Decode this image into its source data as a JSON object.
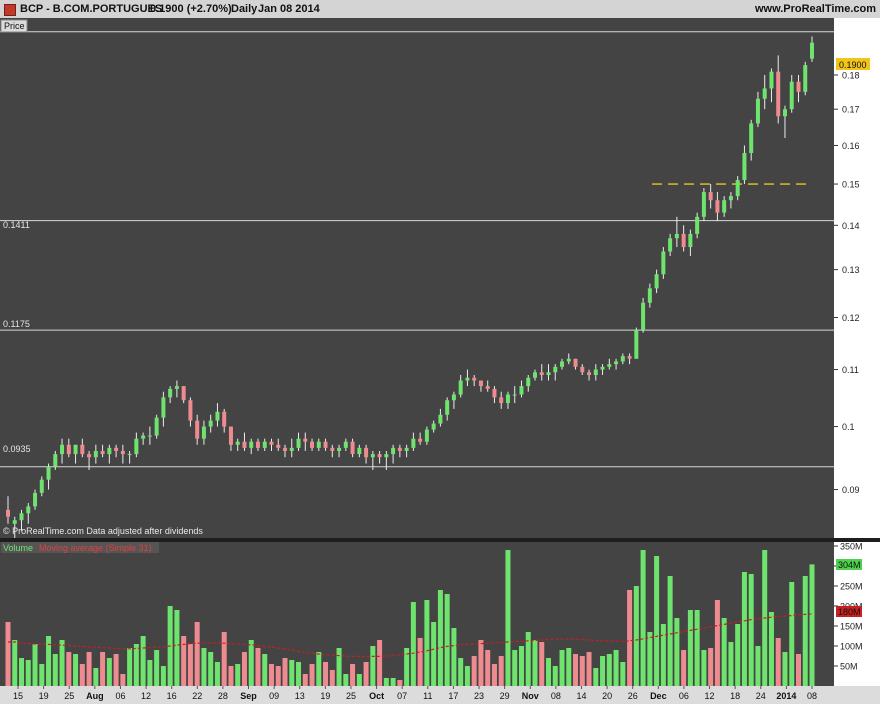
{
  "header": {
    "symbol": "BCP - B.COM.PORTUGUES",
    "quote": "0.1900 (+2.70%)",
    "period": "Daily",
    "date": "Jan 08 2014",
    "site": "www.ProRealTime.com"
  },
  "price_panel": {
    "label": "Price",
    "footer": "© ProRealTime.com  Data adjusted after dividends",
    "current_price_label": "0.1900",
    "level_labels": [
      "0.1411",
      "0.1175",
      "0.0935"
    ]
  },
  "volume_panel": {
    "label_volume": "Volume",
    "label_ma": "Moving average (Simple 31)",
    "current_volume_label": "304M",
    "current_ma_label": "180M"
  },
  "colors": {
    "background": "#444444",
    "up_candle": "#6ee46e",
    "down_candle": "#ee8b90",
    "horizontal_lines": "#d8d8d8",
    "dashed_line": "#e6c619",
    "ma_line": "#c62020",
    "price_tag": "#f0c419"
  },
  "chart_data": [
    {
      "type": "candlestick",
      "title": "BCP - B.COM.PORTUGUES Daily",
      "y_ticks": [
        "0.09",
        "0.1",
        "0.11",
        "0.12",
        "0.13",
        "0.14",
        "0.15",
        "0.16",
        "0.17",
        "0.18"
      ],
      "ylim": [
        0.083,
        0.198
      ],
      "y_scale": "log",
      "horizontal_lines": [
        0.1935,
        0.1411,
        0.1175,
        0.0935
      ],
      "dashed_line": {
        "value": 0.15,
        "from": "Dec 02",
        "to": "Jan 08",
        "style": "dashed"
      },
      "x_tick_labels": [
        "15",
        "19",
        "25",
        "Aug",
        "06",
        "12",
        "16",
        "22",
        "28",
        "Sep",
        "09",
        "13",
        "19",
        "25",
        "Oct",
        "07",
        "11",
        "17",
        "23",
        "29",
        "Nov",
        "08",
        "14",
        "20",
        "26",
        "Dec",
        "06",
        "12",
        "18",
        "24",
        "2014",
        "08"
      ],
      "candles": [
        {
          "o": 0.087,
          "h": 0.089,
          "l": 0.085,
          "c": 0.086
        },
        {
          "o": 0.085,
          "h": 0.086,
          "l": 0.083,
          "c": 0.0855
        },
        {
          "o": 0.0855,
          "h": 0.087,
          "l": 0.084,
          "c": 0.0865
        },
        {
          "o": 0.0865,
          "h": 0.088,
          "l": 0.085,
          "c": 0.0875
        },
        {
          "o": 0.0875,
          "h": 0.09,
          "l": 0.087,
          "c": 0.0895
        },
        {
          "o": 0.0895,
          "h": 0.092,
          "l": 0.089,
          "c": 0.0915
        },
        {
          "o": 0.0915,
          "h": 0.094,
          "l": 0.09,
          "c": 0.0935
        },
        {
          "o": 0.0935,
          "h": 0.096,
          "l": 0.093,
          "c": 0.0955
        },
        {
          "o": 0.0955,
          "h": 0.098,
          "l": 0.094,
          "c": 0.097
        },
        {
          "o": 0.097,
          "h": 0.098,
          "l": 0.095,
          "c": 0.0955
        },
        {
          "o": 0.0955,
          "h": 0.097,
          "l": 0.094,
          "c": 0.097
        },
        {
          "o": 0.097,
          "h": 0.098,
          "l": 0.095,
          "c": 0.0955
        },
        {
          "o": 0.0955,
          "h": 0.096,
          "l": 0.093,
          "c": 0.095
        },
        {
          "o": 0.095,
          "h": 0.097,
          "l": 0.094,
          "c": 0.096
        },
        {
          "o": 0.096,
          "h": 0.097,
          "l": 0.095,
          "c": 0.0955
        },
        {
          "o": 0.0955,
          "h": 0.097,
          "l": 0.094,
          "c": 0.0965
        },
        {
          "o": 0.0965,
          "h": 0.097,
          "l": 0.095,
          "c": 0.096
        },
        {
          "o": 0.096,
          "h": 0.097,
          "l": 0.094,
          "c": 0.0955
        },
        {
          "o": 0.0955,
          "h": 0.096,
          "l": 0.094,
          "c": 0.0955
        },
        {
          "o": 0.0955,
          "h": 0.099,
          "l": 0.095,
          "c": 0.098
        },
        {
          "o": 0.098,
          "h": 0.099,
          "l": 0.097,
          "c": 0.0985
        },
        {
          "o": 0.0985,
          "h": 0.1,
          "l": 0.097,
          "c": 0.0985
        },
        {
          "o": 0.0985,
          "h": 0.102,
          "l": 0.098,
          "c": 0.1015
        },
        {
          "o": 0.1015,
          "h": 0.106,
          "l": 0.1,
          "c": 0.105
        },
        {
          "o": 0.105,
          "h": 0.107,
          "l": 0.104,
          "c": 0.1065
        },
        {
          "o": 0.1065,
          "h": 0.108,
          "l": 0.105,
          "c": 0.107
        },
        {
          "o": 0.107,
          "h": 0.107,
          "l": 0.104,
          "c": 0.1045
        },
        {
          "o": 0.1045,
          "h": 0.105,
          "l": 0.1,
          "c": 0.101
        },
        {
          "o": 0.101,
          "h": 0.102,
          "l": 0.097,
          "c": 0.098
        },
        {
          "o": 0.098,
          "h": 0.101,
          "l": 0.097,
          "c": 0.1
        },
        {
          "o": 0.1,
          "h": 0.102,
          "l": 0.099,
          "c": 0.101
        },
        {
          "o": 0.101,
          "h": 0.104,
          "l": 0.1,
          "c": 0.1025
        },
        {
          "o": 0.1025,
          "h": 0.103,
          "l": 0.099,
          "c": 0.1
        },
        {
          "o": 0.1,
          "h": 0.1,
          "l": 0.096,
          "c": 0.097
        },
        {
          "o": 0.097,
          "h": 0.098,
          "l": 0.096,
          "c": 0.0975
        },
        {
          "o": 0.0975,
          "h": 0.099,
          "l": 0.096,
          "c": 0.0965
        },
        {
          "o": 0.0965,
          "h": 0.098,
          "l": 0.0955,
          "c": 0.0975
        },
        {
          "o": 0.0975,
          "h": 0.098,
          "l": 0.096,
          "c": 0.0965
        },
        {
          "o": 0.0965,
          "h": 0.098,
          "l": 0.096,
          "c": 0.0975
        },
        {
          "o": 0.0975,
          "h": 0.098,
          "l": 0.096,
          "c": 0.097
        },
        {
          "o": 0.097,
          "h": 0.098,
          "l": 0.096,
          "c": 0.0965
        },
        {
          "o": 0.0965,
          "h": 0.097,
          "l": 0.095,
          "c": 0.096
        },
        {
          "o": 0.096,
          "h": 0.098,
          "l": 0.095,
          "c": 0.0965
        },
        {
          "o": 0.0965,
          "h": 0.099,
          "l": 0.096,
          "c": 0.098
        },
        {
          "o": 0.098,
          "h": 0.099,
          "l": 0.096,
          "c": 0.0975
        },
        {
          "o": 0.0975,
          "h": 0.098,
          "l": 0.096,
          "c": 0.0965
        },
        {
          "o": 0.0965,
          "h": 0.098,
          "l": 0.096,
          "c": 0.0975
        },
        {
          "o": 0.0975,
          "h": 0.098,
          "l": 0.096,
          "c": 0.0965
        },
        {
          "o": 0.0965,
          "h": 0.097,
          "l": 0.095,
          "c": 0.096
        },
        {
          "o": 0.096,
          "h": 0.097,
          "l": 0.095,
          "c": 0.0965
        },
        {
          "o": 0.0965,
          "h": 0.098,
          "l": 0.096,
          "c": 0.0975
        },
        {
          "o": 0.0975,
          "h": 0.098,
          "l": 0.095,
          "c": 0.0955
        },
        {
          "o": 0.0955,
          "h": 0.097,
          "l": 0.095,
          "c": 0.0965
        },
        {
          "o": 0.0965,
          "h": 0.097,
          "l": 0.094,
          "c": 0.095
        },
        {
          "o": 0.095,
          "h": 0.096,
          "l": 0.093,
          "c": 0.0955
        },
        {
          "o": 0.0955,
          "h": 0.096,
          "l": 0.094,
          "c": 0.095
        },
        {
          "o": 0.095,
          "h": 0.096,
          "l": 0.093,
          "c": 0.0955
        },
        {
          "o": 0.0955,
          "h": 0.097,
          "l": 0.094,
          "c": 0.0965
        },
        {
          "o": 0.0965,
          "h": 0.097,
          "l": 0.095,
          "c": 0.096
        },
        {
          "o": 0.096,
          "h": 0.097,
          "l": 0.095,
          "c": 0.0965
        },
        {
          "o": 0.0965,
          "h": 0.099,
          "l": 0.096,
          "c": 0.098
        },
        {
          "o": 0.098,
          "h": 0.099,
          "l": 0.097,
          "c": 0.0975
        },
        {
          "o": 0.0975,
          "h": 0.1,
          "l": 0.097,
          "c": 0.0995
        },
        {
          "o": 0.0995,
          "h": 0.101,
          "l": 0.099,
          "c": 0.1005
        },
        {
          "o": 0.1005,
          "h": 0.103,
          "l": 0.1,
          "c": 0.102
        },
        {
          "o": 0.102,
          "h": 0.105,
          "l": 0.101,
          "c": 0.1045
        },
        {
          "o": 0.1045,
          "h": 0.106,
          "l": 0.103,
          "c": 0.1055
        },
        {
          "o": 0.1055,
          "h": 0.109,
          "l": 0.105,
          "c": 0.108
        },
        {
          "o": 0.108,
          "h": 0.11,
          "l": 0.107,
          "c": 0.1085
        },
        {
          "o": 0.1085,
          "h": 0.109,
          "l": 0.107,
          "c": 0.108
        },
        {
          "o": 0.108,
          "h": 0.108,
          "l": 0.106,
          "c": 0.107
        },
        {
          "o": 0.107,
          "h": 0.108,
          "l": 0.106,
          "c": 0.1065
        },
        {
          "o": 0.1065,
          "h": 0.107,
          "l": 0.104,
          "c": 0.105
        },
        {
          "o": 0.105,
          "h": 0.106,
          "l": 0.103,
          "c": 0.104
        },
        {
          "o": 0.104,
          "h": 0.106,
          "l": 0.103,
          "c": 0.1055
        },
        {
          "o": 0.1055,
          "h": 0.107,
          "l": 0.104,
          "c": 0.1055
        },
        {
          "o": 0.1055,
          "h": 0.108,
          "l": 0.105,
          "c": 0.107
        },
        {
          "o": 0.107,
          "h": 0.109,
          "l": 0.106,
          "c": 0.1085
        },
        {
          "o": 0.1085,
          "h": 0.11,
          "l": 0.108,
          "c": 0.1095
        },
        {
          "o": 0.1095,
          "h": 0.111,
          "l": 0.108,
          "c": 0.109
        },
        {
          "o": 0.109,
          "h": 0.111,
          "l": 0.108,
          "c": 0.1095
        },
        {
          "o": 0.1095,
          "h": 0.111,
          "l": 0.108,
          "c": 0.1105
        },
        {
          "o": 0.1105,
          "h": 0.112,
          "l": 0.11,
          "c": 0.1115
        },
        {
          "o": 0.1115,
          "h": 0.113,
          "l": 0.111,
          "c": 0.112
        },
        {
          "o": 0.112,
          "h": 0.112,
          "l": 0.11,
          "c": 0.1105
        },
        {
          "o": 0.1105,
          "h": 0.111,
          "l": 0.109,
          "c": 0.1095
        },
        {
          "o": 0.1095,
          "h": 0.11,
          "l": 0.108,
          "c": 0.109
        },
        {
          "o": 0.109,
          "h": 0.111,
          "l": 0.108,
          "c": 0.11
        },
        {
          "o": 0.11,
          "h": 0.111,
          "l": 0.109,
          "c": 0.1105
        },
        {
          "o": 0.1105,
          "h": 0.112,
          "l": 0.11,
          "c": 0.111
        },
        {
          "o": 0.111,
          "h": 0.112,
          "l": 0.11,
          "c": 0.1115
        },
        {
          "o": 0.1115,
          "h": 0.113,
          "l": 0.111,
          "c": 0.1125
        },
        {
          "o": 0.1125,
          "h": 0.113,
          "l": 0.111,
          "c": 0.112
        },
        {
          "o": 0.112,
          "h": 0.118,
          "l": 0.112,
          "c": 0.1175
        },
        {
          "o": 0.1175,
          "h": 0.124,
          "l": 0.117,
          "c": 0.123
        },
        {
          "o": 0.123,
          "h": 0.127,
          "l": 0.122,
          "c": 0.126
        },
        {
          "o": 0.126,
          "h": 0.13,
          "l": 0.125,
          "c": 0.129
        },
        {
          "o": 0.129,
          "h": 0.135,
          "l": 0.128,
          "c": 0.134
        },
        {
          "o": 0.134,
          "h": 0.138,
          "l": 0.133,
          "c": 0.137
        },
        {
          "o": 0.137,
          "h": 0.142,
          "l": 0.135,
          "c": 0.138
        },
        {
          "o": 0.138,
          "h": 0.14,
          "l": 0.134,
          "c": 0.135
        },
        {
          "o": 0.135,
          "h": 0.139,
          "l": 0.133,
          "c": 0.138
        },
        {
          "o": 0.138,
          "h": 0.143,
          "l": 0.137,
          "c": 0.142
        },
        {
          "o": 0.142,
          "h": 0.149,
          "l": 0.141,
          "c": 0.148
        },
        {
          "o": 0.148,
          "h": 0.15,
          "l": 0.144,
          "c": 0.146
        },
        {
          "o": 0.146,
          "h": 0.148,
          "l": 0.141,
          "c": 0.143
        },
        {
          "o": 0.143,
          "h": 0.147,
          "l": 0.142,
          "c": 0.146
        },
        {
          "o": 0.146,
          "h": 0.148,
          "l": 0.144,
          "c": 0.147
        },
        {
          "o": 0.147,
          "h": 0.152,
          "l": 0.146,
          "c": 0.151
        },
        {
          "o": 0.151,
          "h": 0.16,
          "l": 0.15,
          "c": 0.158
        },
        {
          "o": 0.158,
          "h": 0.167,
          "l": 0.156,
          "c": 0.166
        },
        {
          "o": 0.166,
          "h": 0.175,
          "l": 0.165,
          "c": 0.173
        },
        {
          "o": 0.173,
          "h": 0.18,
          "l": 0.17,
          "c": 0.176
        },
        {
          "o": 0.176,
          "h": 0.182,
          "l": 0.172,
          "c": 0.181
        },
        {
          "o": 0.181,
          "h": 0.186,
          "l": 0.166,
          "c": 0.168
        },
        {
          "o": 0.168,
          "h": 0.171,
          "l": 0.162,
          "c": 0.17
        },
        {
          "o": 0.17,
          "h": 0.18,
          "l": 0.169,
          "c": 0.178
        },
        {
          "o": 0.178,
          "h": 0.18,
          "l": 0.172,
          "c": 0.175
        },
        {
          "o": 0.175,
          "h": 0.184,
          "l": 0.174,
          "c": 0.183
        },
        {
          "o": 0.185,
          "h": 0.192,
          "l": 0.184,
          "c": 0.19
        }
      ]
    },
    {
      "type": "bar",
      "title": "Volume",
      "unit": "M",
      "y_ticks": [
        "50M",
        "100M",
        "150M",
        "200M",
        "250M",
        "300M",
        "350M"
      ],
      "ylim": [
        0,
        360
      ],
      "series": [
        {
          "name": "Volume",
          "values": [
            160,
            115,
            70,
            65,
            105,
            55,
            125,
            80,
            115,
            85,
            80,
            55,
            85,
            45,
            85,
            70,
            80,
            30,
            95,
            105,
            125,
            65,
            90,
            50,
            200,
            190,
            125,
            105,
            160,
            95,
            85,
            60,
            135,
            50,
            55,
            85,
            115,
            95,
            80,
            55,
            50,
            70,
            65,
            60,
            30,
            55,
            85,
            60,
            40,
            95,
            30,
            55,
            30,
            60,
            100,
            115,
            20,
            20,
            15,
            95,
            210,
            120,
            215,
            160,
            240,
            230,
            145,
            70,
            50,
            75,
            115,
            90,
            55,
            75,
            340,
            90,
            100,
            135,
            115,
            110,
            70,
            50,
            90,
            95,
            80,
            75,
            85,
            45,
            75,
            80,
            90,
            60,
            240,
            250,
            340,
            135,
            325,
            155,
            275,
            170,
            90,
            190,
            190,
            90,
            95,
            215,
            170,
            110,
            155,
            285,
            280,
            100,
            340,
            185,
            120,
            85,
            260,
            80,
            275,
            304
          ]
        },
        {
          "name": "Moving average (Simple 31)",
          "values": [
            110,
            110,
            108,
            106,
            105,
            104,
            104,
            103,
            102,
            101,
            100,
            99,
            98,
            97,
            96,
            95,
            94,
            93,
            93,
            94,
            95,
            96,
            97,
            98,
            100,
            102,
            104,
            106,
            107,
            108,
            108,
            108,
            107,
            106,
            105,
            104,
            103,
            101,
            99,
            97,
            95,
            93,
            90,
            87,
            84,
            82,
            80,
            78,
            77,
            76,
            75,
            74,
            74,
            74,
            74,
            74,
            75,
            76,
            78,
            80,
            82,
            85,
            88,
            92,
            96,
            99,
            101,
            103,
            104,
            105,
            106,
            107,
            108,
            109,
            110,
            111,
            112,
            113,
            114,
            115,
            116,
            117,
            117,
            117,
            117,
            116,
            115,
            114,
            113,
            112,
            112,
            112,
            113,
            115,
            118,
            121,
            124,
            127,
            130,
            133,
            136,
            139,
            142,
            145,
            148,
            151,
            154,
            157,
            160,
            163,
            166,
            168,
            170,
            172,
            174,
            175,
            176,
            178,
            179,
            180
          ]
        }
      ]
    }
  ]
}
